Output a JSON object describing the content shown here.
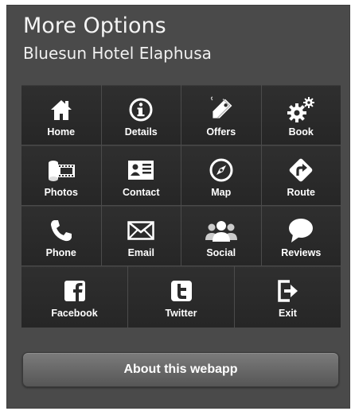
{
  "header": {
    "title": "More Options",
    "subtitle": "Bluesun Hotel Elaphusa"
  },
  "tiles": [
    {
      "label": "Home",
      "icon": "home-icon"
    },
    {
      "label": "Details",
      "icon": "info-icon"
    },
    {
      "label": "Offers",
      "icon": "tag-icon"
    },
    {
      "label": "Book",
      "icon": "gears-icon"
    },
    {
      "label": "Photos",
      "icon": "film-icon"
    },
    {
      "label": "Contact",
      "icon": "contact-card-icon"
    },
    {
      "label": "Map",
      "icon": "compass-icon"
    },
    {
      "label": "Route",
      "icon": "route-sign-icon"
    },
    {
      "label": "Phone",
      "icon": "phone-icon"
    },
    {
      "label": "Email",
      "icon": "envelope-icon"
    },
    {
      "label": "Social",
      "icon": "people-icon"
    },
    {
      "label": "Reviews",
      "icon": "speech-bubble-icon"
    },
    {
      "label": "Facebook",
      "icon": "facebook-icon"
    },
    {
      "label": "Twitter",
      "icon": "twitter-icon"
    },
    {
      "label": "Exit",
      "icon": "exit-icon"
    }
  ],
  "footer": {
    "about_label": "About this webapp"
  },
  "colors": {
    "panel": "#4a4a4a",
    "tile": "#2b2b2b",
    "text": "#ffffff",
    "button": "#6a6a6a"
  }
}
